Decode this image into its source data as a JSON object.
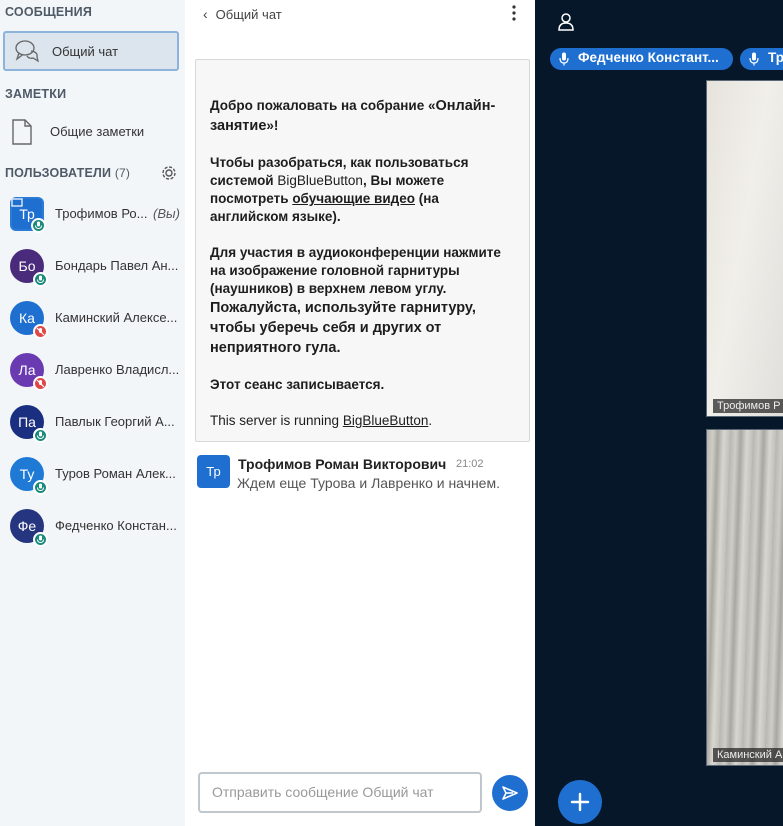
{
  "sidebar": {
    "messages_title": "СООБЩЕНИЯ",
    "public_chat_label": "Общий чат",
    "notes_title": "ЗАМЕТКИ",
    "shared_notes_label": "Общие заметки",
    "users_title": "ПОЛЬЗОВАТЕЛИ",
    "users_count": "(7)",
    "users": [
      {
        "initials": "Тр",
        "name": "Трофимов Ро...",
        "you": "(Вы)",
        "color": "#1f6fd1",
        "mic": "on"
      },
      {
        "initials": "Бо",
        "name": "Бондарь Павел Ан...",
        "color": "#4a2b7b",
        "mic": "on"
      },
      {
        "initials": "Ка",
        "name": "Каминский Алексе...",
        "color": "#1f6fd1",
        "mic": "muted"
      },
      {
        "initials": "Ла",
        "name": "Лавренко Владисл...",
        "color": "#6a3bb0",
        "mic": "muted"
      },
      {
        "initials": "Па",
        "name": "Павлык Георгий А...",
        "color": "#1a2f80",
        "mic": "on"
      },
      {
        "initials": "Ту",
        "name": "Туров Роман Алек...",
        "color": "#1f7ad6",
        "mic": "on"
      },
      {
        "initials": "Фе",
        "name": "Федченко Констан...",
        "color": "#25357f",
        "mic": "on"
      }
    ]
  },
  "chat": {
    "header_title": "Общий чат",
    "welcome": {
      "p1_pre": "Добро пожаловать на собрание «",
      "p1_bold": "Онлайн-занятие",
      "p1_post": "»!",
      "p2_a": "Чтобы разобраться, как пользоваться системой ",
      "p2_brand": "BigBlueButton",
      "p2_b": ", Вы можете посмотреть ",
      "p2_link": "обучающие видео",
      "p2_c": " (на английском языке).",
      "p3_a": "Для участия в аудиоконференции нажмите на изображение головной гарнитуры (наушников) в верхнем левом углу. ",
      "p3_bold": "Пожалуйста, используйте гарнитуру, чтобы уберечь себя и других от неприятного гула.",
      "p4": "Этот сеанс записывается.",
      "p5_a": "This server is running ",
      "p5_link": "BigBlueButton",
      "p5_b": "."
    },
    "message": {
      "initials": "Тр",
      "author": "Трофимов Роман Викторович",
      "time": "21:02",
      "text": "Ждем еще Турова и Лавренко и начнем."
    },
    "input_placeholder": "Отправить сообщение Общий чат"
  },
  "video": {
    "talkers": [
      "Федченко Констант...",
      "Тр"
    ],
    "tiles": [
      "Трофимов Р",
      "Каминский А"
    ]
  },
  "colors": {
    "accent": "#1f6fd1",
    "video_bg": "#06172a",
    "sidebar_bg": "#f3f6f9"
  }
}
